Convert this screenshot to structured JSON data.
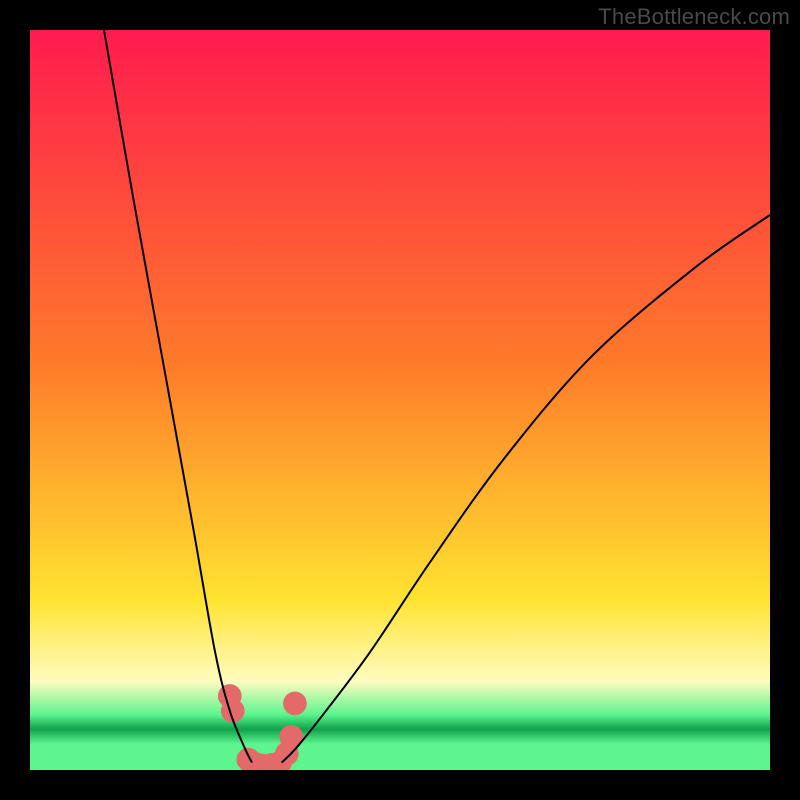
{
  "attribution": "TheBottleneck.com",
  "colors": {
    "frame": "#000000",
    "grad_top": "#ff1b4e",
    "grad_mid1": "#ff7a2a",
    "grad_mid2": "#ffe330",
    "grad_low": "#fffcc0",
    "grad_green_dark": "#0fa24a",
    "grad_green_light": "#5df58f",
    "curve": "#000000",
    "markers": "#e46a6a"
  },
  "chart_data": {
    "type": "line",
    "title": "",
    "xlabel": "",
    "ylabel": "",
    "xlim": [
      0,
      100
    ],
    "ylim": [
      0,
      100
    ],
    "grid": false,
    "legend": false,
    "annotations": [],
    "series": [
      {
        "name": "left-branch",
        "x": [
          10,
          14,
          18,
          22,
          25,
          27,
          29,
          30
        ],
        "values": [
          100,
          77,
          55,
          33,
          16,
          8,
          3,
          1
        ]
      },
      {
        "name": "right-branch",
        "x": [
          34,
          36,
          40,
          46,
          54,
          64,
          76,
          90,
          100
        ],
        "values": [
          1,
          3,
          8,
          16,
          28,
          42,
          56,
          68,
          75
        ]
      },
      {
        "name": "markers",
        "x": [
          27.0,
          27.4,
          29.5,
          30.5,
          31.5,
          32.7,
          33.8,
          34.7,
          35.3,
          35.8
        ],
        "values": [
          10.0,
          8.0,
          1.4,
          0.8,
          0.6,
          0.7,
          1.0,
          2.2,
          4.5,
          9.0
        ]
      }
    ],
    "gradient_stops": [
      {
        "offset": 0.0,
        "name": "top",
        "color_key": "grad_top"
      },
      {
        "offset": 0.45,
        "name": "mid1",
        "color_key": "grad_mid1"
      },
      {
        "offset": 0.77,
        "name": "mid2",
        "color_key": "grad_mid2"
      },
      {
        "offset": 0.88,
        "name": "low",
        "color_key": "grad_low"
      },
      {
        "offset": 0.925,
        "name": "green_light",
        "color_key": "grad_green_light"
      },
      {
        "offset": 0.945,
        "name": "green_dark",
        "color_key": "grad_green_dark"
      },
      {
        "offset": 0.965,
        "name": "green_light2",
        "color_key": "grad_green_light"
      },
      {
        "offset": 1.0,
        "name": "green_light3",
        "color_key": "grad_green_light"
      }
    ],
    "marker_radius_y": 1.6
  }
}
